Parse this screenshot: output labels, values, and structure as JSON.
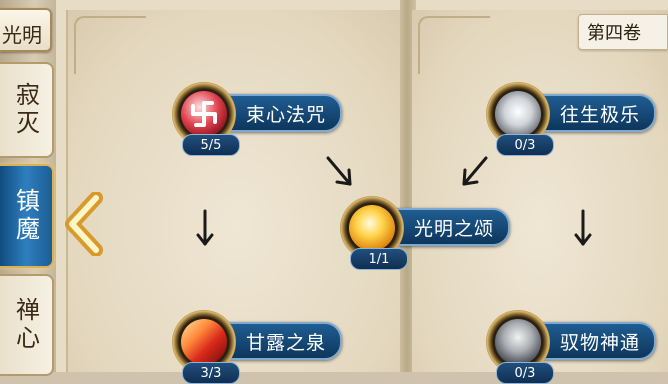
{
  "sidebar": {
    "top_tab_label": "光明",
    "tabs": [
      {
        "label": "寂灭",
        "active": false
      },
      {
        "label": "镇魔",
        "active": true
      },
      {
        "label": "禅心",
        "active": false
      }
    ]
  },
  "volume_tab": {
    "label": "第四卷"
  },
  "skills": [
    {
      "name": "束心法咒",
      "progress": "5/5",
      "icon": "red-swirl-icon"
    },
    {
      "name": "往生极乐",
      "progress": "0/3",
      "icon": "white-lotus-icon"
    },
    {
      "name": "光明之颂",
      "progress": "1/1",
      "icon": "golden-light-icon"
    },
    {
      "name": "甘露之泉",
      "progress": "3/3",
      "icon": "crimson-blade-icon"
    },
    {
      "name": "驭物神通",
      "progress": "0/3",
      "icon": "grey-spirit-icon"
    }
  ],
  "colors": {
    "banner_blue": "#0d365c",
    "active_tab_blue": "#1c5d94",
    "gold_trim": "#d9b66a"
  }
}
